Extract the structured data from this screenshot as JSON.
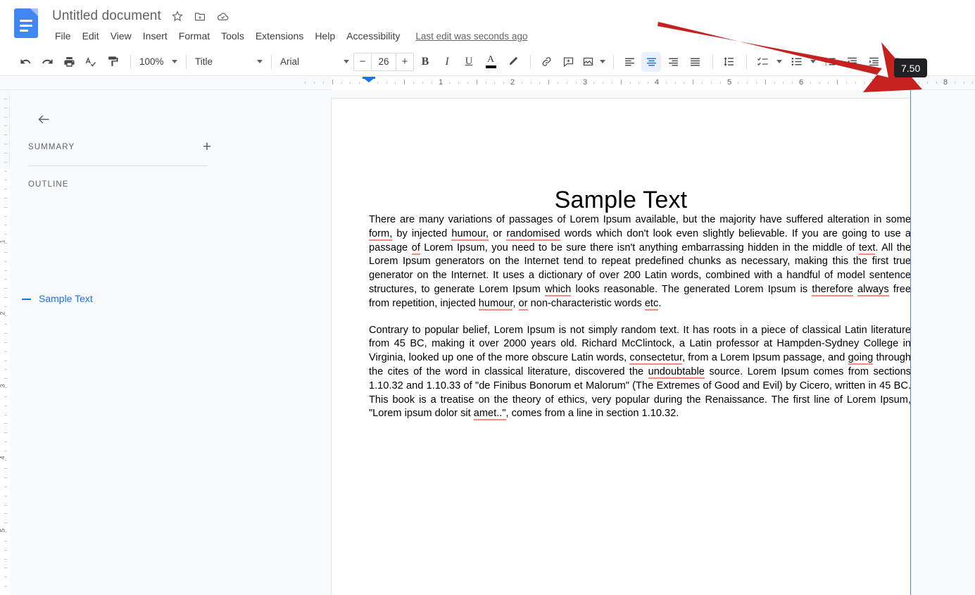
{
  "app": {
    "name": "Google Docs",
    "doc_icon": "docs-icon"
  },
  "header": {
    "title": "Untitled document",
    "title_icons": [
      {
        "name": "star-icon",
        "glyph": "☆"
      },
      {
        "name": "move-to-folder-icon",
        "glyph": "folder"
      },
      {
        "name": "saved-to-drive-icon",
        "glyph": "cloud"
      }
    ],
    "menu": [
      {
        "label": "File"
      },
      {
        "label": "Edit"
      },
      {
        "label": "View"
      },
      {
        "label": "Insert"
      },
      {
        "label": "Format"
      },
      {
        "label": "Tools"
      },
      {
        "label": "Extensions"
      },
      {
        "label": "Help"
      },
      {
        "label": "Accessibility"
      }
    ],
    "last_edit": "Last edit was seconds ago"
  },
  "toolbar": {
    "undo": "undo-icon",
    "redo": "redo-icon",
    "print": "print-icon",
    "spelling": "spell-check-icon",
    "paint_format": "paint-format-icon",
    "zoom_value": "100%",
    "style_value": "Title",
    "font_value": "Arial",
    "font_size_value": "26",
    "font_size_decrease": "−",
    "font_size_increase": "+",
    "bold": "B",
    "italic": "I",
    "underline": "U",
    "text_color": "A",
    "highlight": "highlight-pen-icon",
    "insert_link": "link-icon",
    "add_comment": "add-comment-icon",
    "insert_image": "insert-image-icon",
    "align_left": "align-left-icon",
    "align_center": "align-center-icon",
    "align_right": "align-right-icon",
    "align_justify": "align-justify-icon",
    "line_spacing": "line-spacing-icon",
    "checklist": "checklist-icon",
    "bulleted_list": "bulleted-list-icon",
    "numbered_list": "numbered-list-icon",
    "decrease_indent": "decrease-indent-icon",
    "increase_indent": "increase-indent-icon",
    "clear_formatting": "clear-formatting-icon",
    "active_alignment": "align-center"
  },
  "ruler": {
    "horizontal_numbers": [
      "1",
      "2",
      "3",
      "4",
      "5",
      "6",
      "7",
      "8"
    ],
    "vertical_numbers": [
      "1",
      "2",
      "3",
      "4",
      "5"
    ],
    "left_indent_marker": "left-indent-marker",
    "right_indent_marker": "right-indent-marker"
  },
  "sidebar": {
    "back": "back-arrow-icon",
    "summary_heading": "SUMMARY",
    "add_summary": "+",
    "outline_heading": "OUTLINE",
    "outline_items": [
      {
        "label": "Sample Text"
      }
    ]
  },
  "document": {
    "heading": "Sample Text",
    "paragraphs": [
      "There are many variations of passages of Lorem Ipsum available, but the majority have suffered alteration in some form, by injected humour, or randomised words which don't look even slightly believable. If you are going to use a passage of Lorem Ipsum, you need to be sure there isn't anything embarrassing hidden in the middle of text. All the Lorem Ipsum generators on the Internet tend to repeat predefined chunks as necessary, making this the first true generator on the Internet. It uses a dictionary of over 200 Latin words, combined with a handful of model sentence structures, to generate Lorem Ipsum which looks reasonable. The generated Lorem Ipsum is therefore always free from repetition, injected humour, or non-characteristic words etc.",
      "Contrary to popular belief, Lorem Ipsum is not simply random text. It has roots in a piece of classical Latin literature from 45 BC, making it over 2000 years old. Richard McClintock, a Latin professor at Hampden-Sydney College in Virginia, looked up one of the more obscure Latin words, consectetur, from a Lorem Ipsum passage, and going through the cites of the word in classical literature, discovered the undoubtable source. Lorem Ipsum comes from sections 1.10.32 and 1.10.33 of \"de Finibus Bonorum et Malorum\" (The Extremes of Good and Evil) by Cicero, written in 45 BC. This book is a treatise on the theory of ethics, very popular during the Renaissance. The first line of Lorem Ipsum, \"Lorem ipsum dolor sit amet..\", comes from a line in section 1.10.32."
    ],
    "spellcheck_words": [
      "form,",
      "humour,",
      "randomised",
      "of",
      "text",
      "which",
      "therefore",
      "always",
      "humour",
      "or",
      "etc",
      "consectetur",
      "going",
      "undoubtable",
      "amet..",
      ","
    ]
  },
  "annotation": {
    "tooltip_value": "7.50",
    "arrow_color": "#c5221f",
    "arrow_name": "red-pointer-arrow"
  },
  "colors": {
    "accent": "#1a73e8",
    "brand_blue": "#4285f4",
    "toolbar_icon": "#444746",
    "spellcheck_red": "#f28b82",
    "tooltip_bg": "#202124"
  }
}
